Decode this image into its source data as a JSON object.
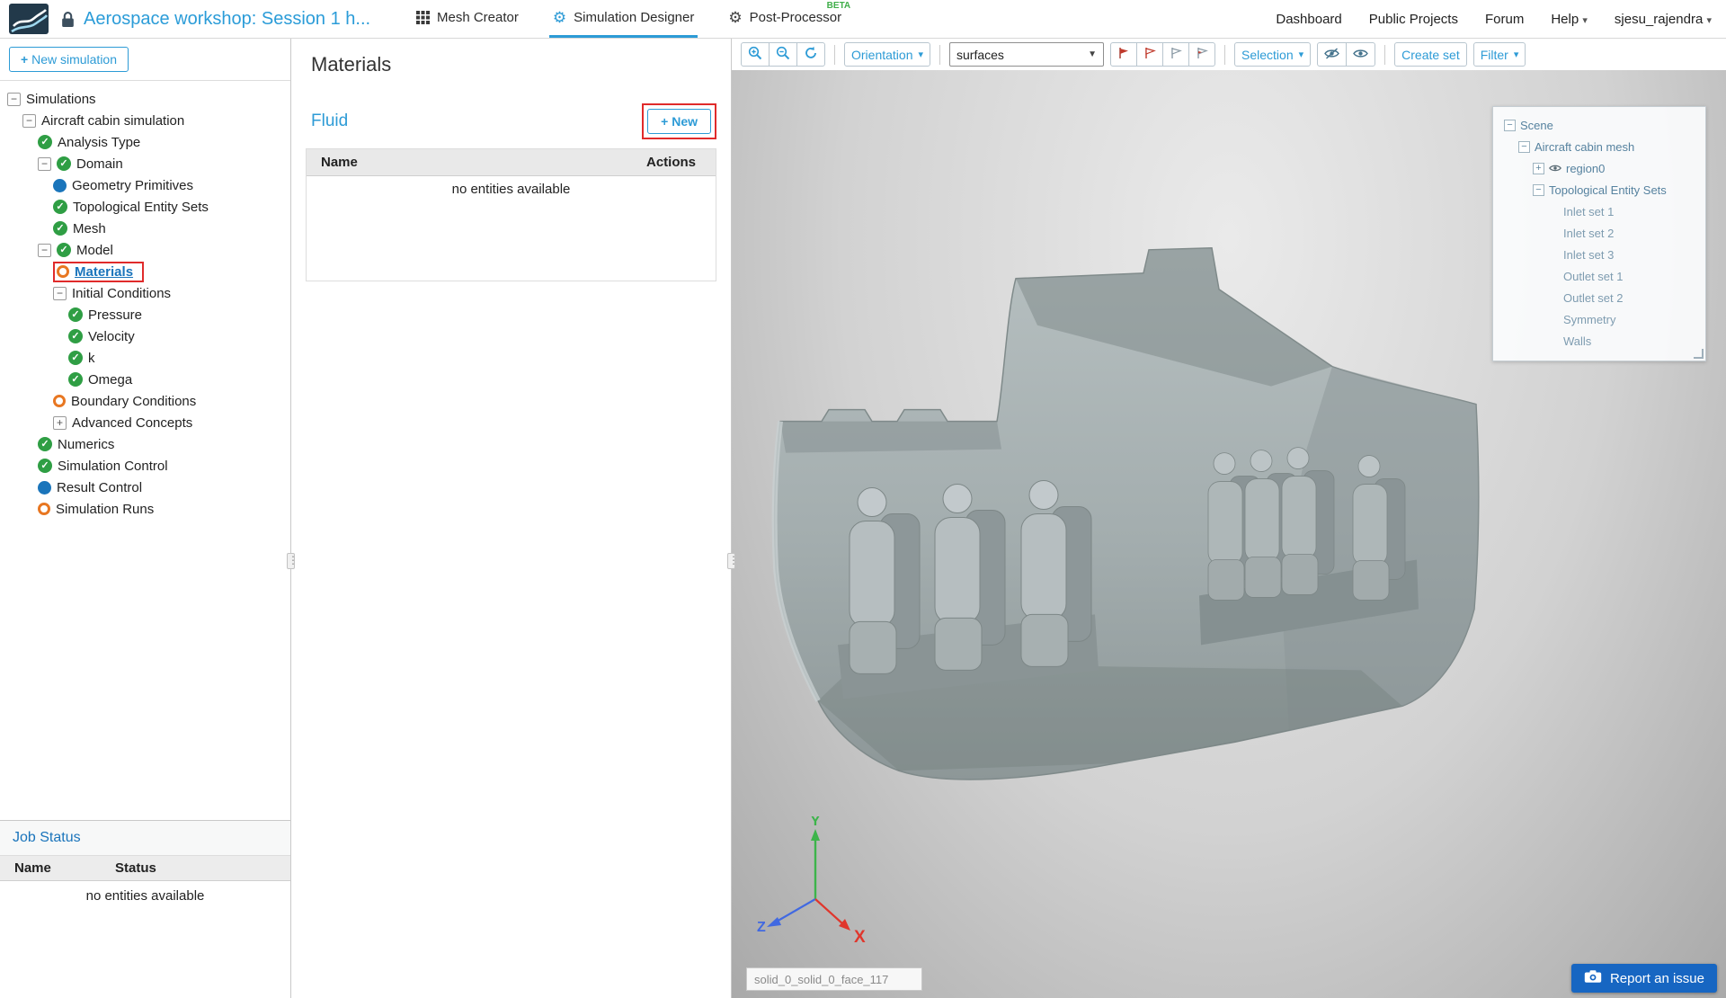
{
  "header": {
    "project_title": "Aerospace workshop: Session 1 h...",
    "tabs": [
      {
        "label": "Mesh Creator",
        "icon": "grid-icon",
        "active": false
      },
      {
        "label": "Simulation Designer",
        "icon": "gears-icon",
        "active": true
      },
      {
        "label": "Post-Processor",
        "icon": "gear-icon",
        "active": false,
        "badge": "BETA"
      }
    ],
    "nav": [
      {
        "label": "Dashboard",
        "dropdown": false
      },
      {
        "label": "Public Projects",
        "dropdown": false
      },
      {
        "label": "Forum",
        "dropdown": false
      },
      {
        "label": "Help",
        "dropdown": true
      },
      {
        "label": "sjesu_rajendra",
        "dropdown": true
      }
    ]
  },
  "sidebar": {
    "new_simulation_label": "New simulation",
    "tree": [
      {
        "label": "Simulations",
        "depth": 0,
        "expander": "minus",
        "icon": "none",
        "selected": false
      },
      {
        "label": "Aircraft cabin simulation",
        "depth": 1,
        "expander": "minus",
        "icon": "none",
        "selected": false
      },
      {
        "label": "Analysis Type",
        "depth": 2,
        "expander": "none",
        "icon": "check",
        "selected": false
      },
      {
        "label": "Domain",
        "depth": 2,
        "expander": "minus",
        "icon": "check",
        "selected": false
      },
      {
        "label": "Geometry Primitives",
        "depth": 3,
        "expander": "none",
        "icon": "dot",
        "selected": false
      },
      {
        "label": "Topological Entity Sets",
        "depth": 3,
        "expander": "none",
        "icon": "check",
        "selected": false
      },
      {
        "label": "Mesh",
        "depth": 3,
        "expander": "none",
        "icon": "check",
        "selected": false
      },
      {
        "label": "Model",
        "depth": 2,
        "expander": "minus",
        "icon": "check",
        "selected": false
      },
      {
        "label": "Materials",
        "depth": 3,
        "expander": "none",
        "icon": "ring",
        "selected": true
      },
      {
        "label": "Initial Conditions",
        "depth": 3,
        "expander": "minus",
        "icon": "none",
        "selected": false
      },
      {
        "label": "Pressure",
        "depth": 4,
        "expander": "none",
        "icon": "check",
        "selected": false
      },
      {
        "label": "Velocity",
        "depth": 4,
        "expander": "none",
        "icon": "check",
        "selected": false
      },
      {
        "label": "k",
        "depth": 4,
        "expander": "none",
        "icon": "check",
        "selected": false
      },
      {
        "label": "Omega",
        "depth": 4,
        "expander": "none",
        "icon": "check",
        "selected": false
      },
      {
        "label": "Boundary Conditions",
        "depth": 3,
        "expander": "none",
        "icon": "ring",
        "selected": false
      },
      {
        "label": "Advanced Concepts",
        "depth": 3,
        "expander": "plus",
        "icon": "none",
        "selected": false
      },
      {
        "label": "Numerics",
        "depth": 2,
        "expander": "none",
        "icon": "check",
        "selected": false
      },
      {
        "label": "Simulation Control",
        "depth": 2,
        "expander": "none",
        "icon": "check",
        "selected": false
      },
      {
        "label": "Result Control",
        "depth": 2,
        "expander": "none",
        "icon": "dot",
        "selected": false
      },
      {
        "label": "Simulation Runs",
        "depth": 2,
        "expander": "none",
        "icon": "ring",
        "selected": false
      }
    ],
    "job_status": {
      "title": "Job Status",
      "columns": [
        "Name",
        "Status"
      ],
      "empty_text": "no entities available"
    }
  },
  "materials_panel": {
    "title": "Materials",
    "section_title": "Fluid",
    "new_button_label": "New",
    "table": {
      "columns": [
        "Name",
        "Actions"
      ],
      "empty_text": "no entities available"
    }
  },
  "viewport": {
    "toolbar": {
      "orientation_label": "Orientation",
      "render_mode_value": "surfaces",
      "selection_label": "Selection",
      "create_set_label": "Create set",
      "filter_label": "Filter",
      "icons": [
        "zoom-in-icon",
        "zoom-fit-icon",
        "refresh-icon",
        "flag-filled-icon",
        "flag-red-outline-icon",
        "flag-gray-outline-icon",
        "flag-gray-red-icon",
        "eye-off-icon",
        "eye-icon"
      ]
    },
    "scene_tree": [
      {
        "label": "Scene",
        "depth": 0,
        "expander": "minus",
        "eye": false
      },
      {
        "label": "Aircraft cabin mesh",
        "depth": 1,
        "expander": "minus",
        "eye": false
      },
      {
        "label": "region0",
        "depth": 2,
        "expander": "plus",
        "eye": true
      },
      {
        "label": "Topological Entity Sets",
        "depth": 2,
        "expander": "minus",
        "eye": false
      },
      {
        "label": "Inlet set 1",
        "depth": 3,
        "expander": "none",
        "eye": false
      },
      {
        "label": "Inlet set 2",
        "depth": 3,
        "expander": "none",
        "eye": false
      },
      {
        "label": "Inlet set 3",
        "depth": 3,
        "expander": "none",
        "eye": false
      },
      {
        "label": "Outlet set 1",
        "depth": 3,
        "expander": "none",
        "eye": false
      },
      {
        "label": "Outlet set 2",
        "depth": 3,
        "expander": "none",
        "eye": false
      },
      {
        "label": "Symmetry",
        "depth": 3,
        "expander": "none",
        "eye": false
      },
      {
        "label": "Walls",
        "depth": 3,
        "expander": "none",
        "eye": false
      }
    ],
    "axis_labels": {
      "x": "X",
      "y": "Y",
      "z": "Z"
    },
    "face_field_value": "solid_0_solid_0_face_117",
    "report_issue_label": "Report an issue"
  },
  "colors": {
    "accent_blue": "#2d9bd6",
    "link_blue": "#1a74bb",
    "check_green": "#2f9e44",
    "warn_orange": "#e87722",
    "annotation_red": "#e02b2b",
    "report_button_blue": "#1766c2",
    "axis_x_red": "#e0362c",
    "axis_y_green": "#3cb44a",
    "axis_z_blue": "#4169e1"
  }
}
